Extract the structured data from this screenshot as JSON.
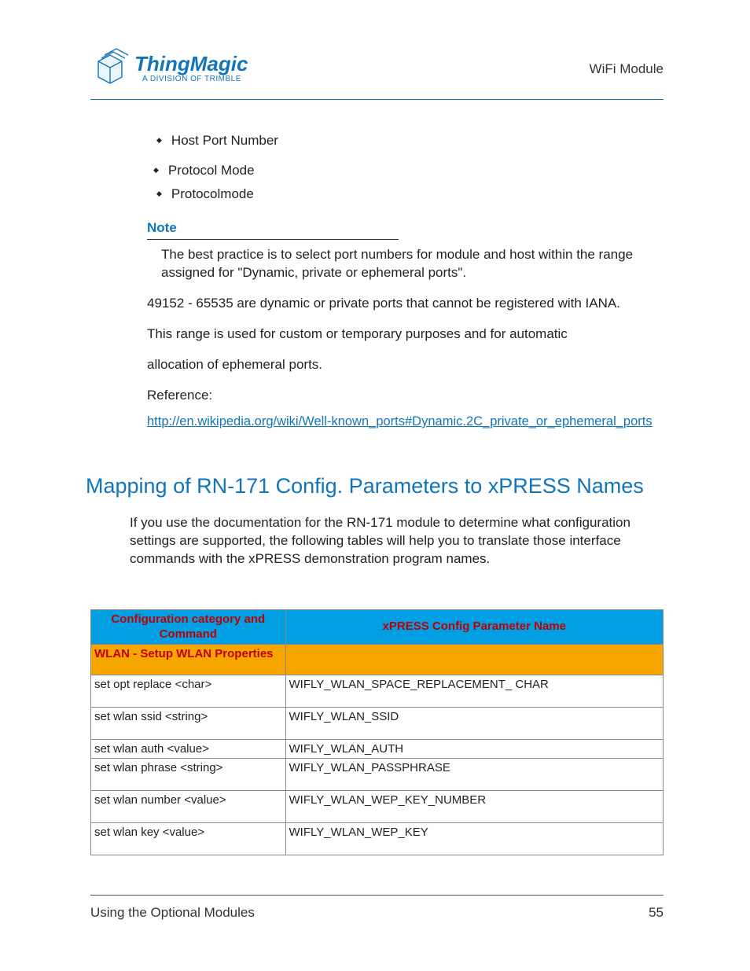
{
  "header": {
    "brand": "ThingMagic",
    "tagline": "A DIVISION OF TRIMBLE",
    "right": "WiFi Module"
  },
  "bullets": {
    "b1": "Host Port Number",
    "b2": "Protocol Mode",
    "b2a": "Protocolmode"
  },
  "note": {
    "title": "Note",
    "p1": "The best practice is to select port numbers for module and host within the range assigned for \"Dynamic, private or ephemeral ports\".",
    "p2": "49152 - 65535 are dynamic or private ports that cannot be registered with IANA.",
    "p3": "This range is used for custom or temporary purposes and for automatic",
    "p4": "allocation of ephemeral ports.",
    "p5": "Reference:",
    "link": "http://en.wikipedia.org/wiki/Well-known_ports#Dynamic.2C_private_or_ephemeral_ports"
  },
  "section": {
    "title": "Mapping of RN-171 Config. Parameters to xPRESS Names",
    "intro": "If you use the documentation for the RN-171 module to determine what configuration settings are supported, the following tables will help you to translate those interface commands with the xPRESS demonstration program names."
  },
  "table": {
    "head1": "Configuration category and Command",
    "head2": "xPRESS Config Parameter Name",
    "sub1": "WLAN - Setup WLAN Properties",
    "rows": [
      {
        "cmd": "set opt replace <char>",
        "param": "WIFLY_WLAN_SPACE_REPLACEMENT_\nCHAR",
        "tall": true
      },
      {
        "cmd": "set wlan ssid <string>",
        "param": "WIFLY_WLAN_SSID",
        "tall": true
      },
      {
        "cmd": "set wlan auth <value>",
        "param": "WIFLY_WLAN_AUTH",
        "tall": false
      },
      {
        "cmd": "set wlan phrase <string>",
        "param": "WIFLY_WLAN_PASSPHRASE",
        "tall": true
      },
      {
        "cmd": "set wlan number <value>",
        "param": "WIFLY_WLAN_WEP_KEY_NUMBER",
        "tall": true
      },
      {
        "cmd": "set wlan key <value>",
        "param": "WIFLY_WLAN_WEP_KEY",
        "tall": true
      }
    ]
  },
  "footer": {
    "left": "Using the Optional Modules",
    "right": "55"
  }
}
